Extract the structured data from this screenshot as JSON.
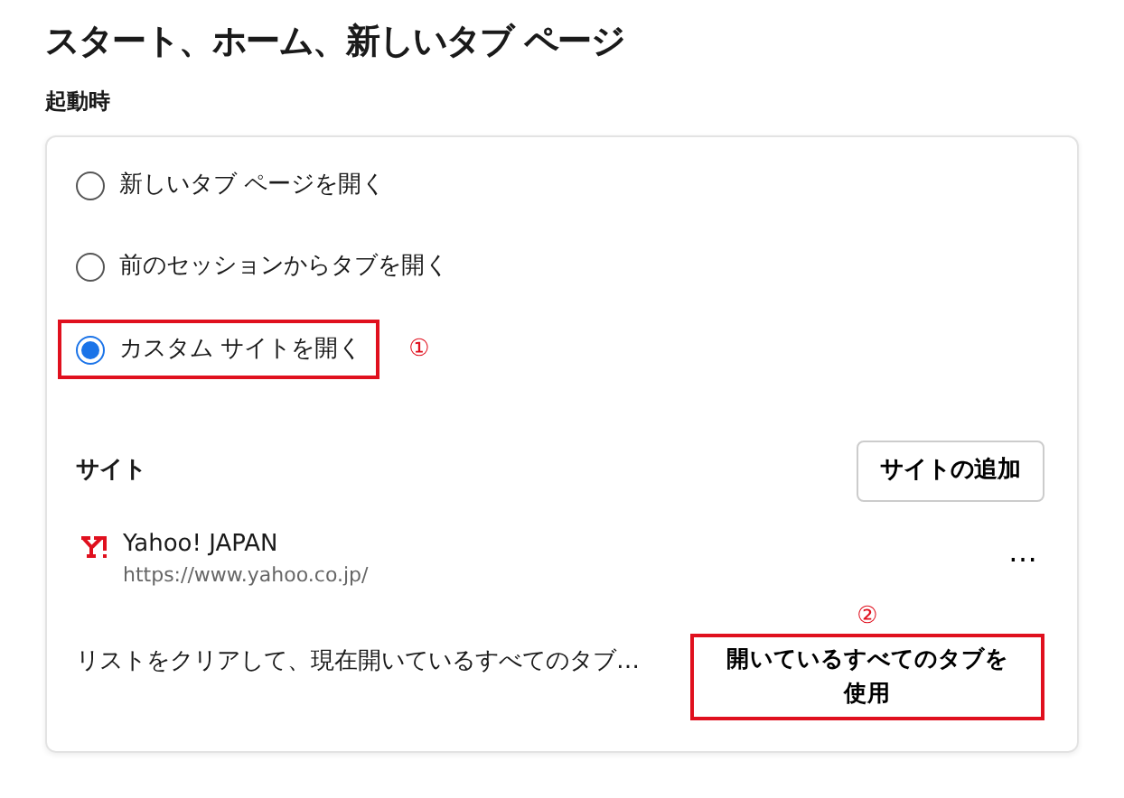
{
  "title": "スタート、ホーム、新しいタブ ページ",
  "section_label": "起動時",
  "startup_options": [
    {
      "label": "新しいタブ ページを開く",
      "selected": false,
      "highlighted": false
    },
    {
      "label": "前のセッションからタブを開く",
      "selected": false,
      "highlighted": false
    },
    {
      "label": "カスタム サイトを開く",
      "selected": true,
      "highlighted": true,
      "marker": "①"
    }
  ],
  "sites_heading": "サイト",
  "add_site_button": "サイトの追加",
  "sites": [
    {
      "name": "Yahoo! JAPAN",
      "url": "https://www.yahoo.co.jp/",
      "more": "…"
    }
  ],
  "use_tabs": {
    "description": "リストをクリアして、現在開いているすべてのタブ…",
    "button": "開いているすべてのタブを使用",
    "highlighted": true,
    "marker": "②"
  }
}
